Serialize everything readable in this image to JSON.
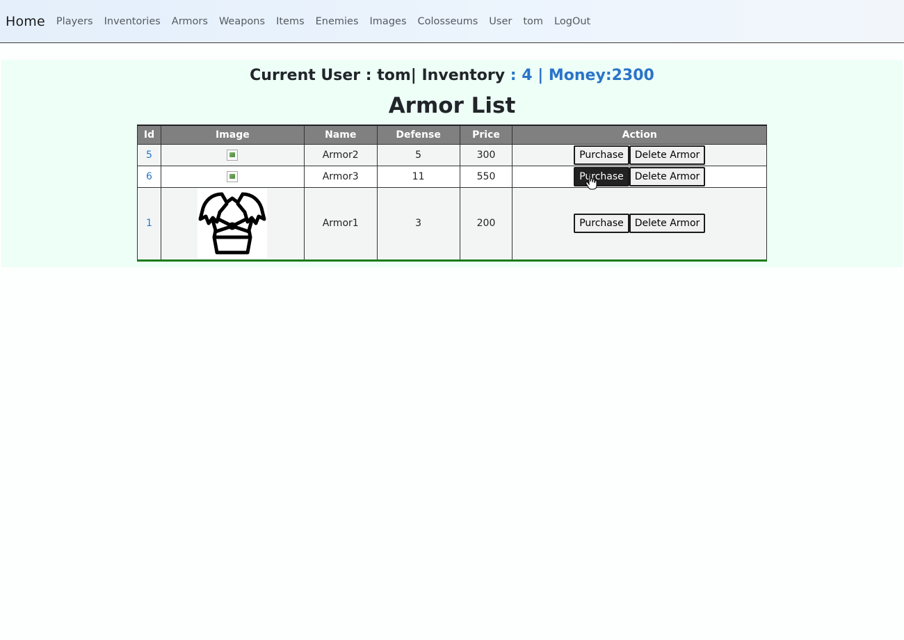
{
  "nav": {
    "brand": "Home",
    "links": [
      "Players",
      "Inventories",
      "Armors",
      "Weapons",
      "Items",
      "Enemies",
      "Images",
      "Colosseums",
      "User",
      "tom",
      "LogOut"
    ]
  },
  "status": {
    "prefix": "Current User : tom| Inventory ",
    "suffix": ": 4 | Money:2300"
  },
  "page_title": "Armor List",
  "table": {
    "headers": [
      "Id",
      "Image",
      "Name",
      "Defense",
      "Price",
      "Action"
    ],
    "rows": [
      {
        "id": "5",
        "name": "Armor2",
        "defense": "5",
        "price": "300"
      },
      {
        "id": "6",
        "name": "Armor3",
        "defense": "11",
        "price": "550"
      },
      {
        "id": "1",
        "name": "Armor1",
        "defense": "3",
        "price": "200"
      }
    ],
    "purchase_label": "Purchase",
    "delete_label": "Delete Armor"
  },
  "colors": {
    "header_bg": "#808080",
    "link_blue": "#2a74c9",
    "panel_bg": "#edfff7"
  }
}
